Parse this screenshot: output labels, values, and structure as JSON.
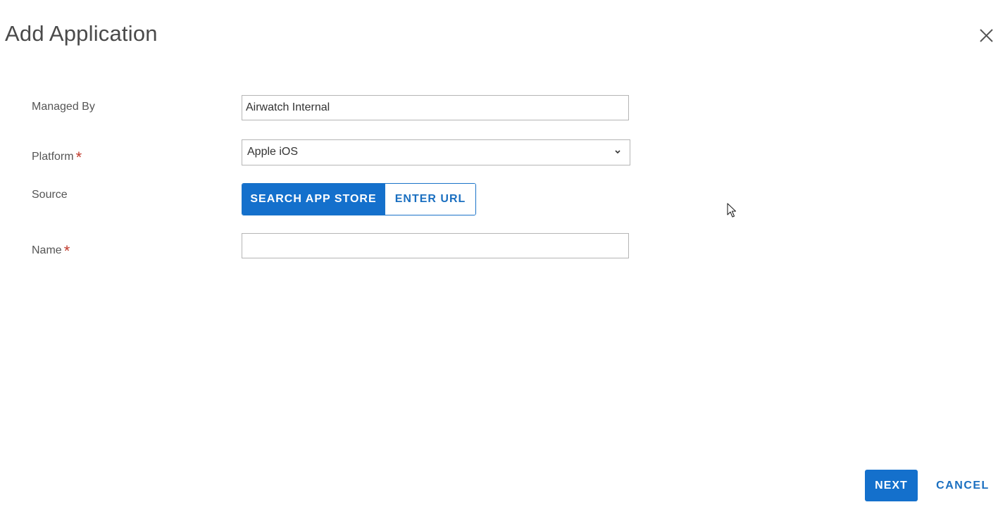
{
  "dialog": {
    "title": "Add Application",
    "close_icon": "close-icon"
  },
  "form": {
    "managed_by": {
      "label": "Managed By",
      "value": "Airwatch Internal"
    },
    "platform": {
      "label": "Platform",
      "required_mark": "*",
      "selected": "Apple iOS",
      "chevron_icon": "chevron-down-icon"
    },
    "source": {
      "label": "Source",
      "options": [
        {
          "label": "SEARCH APP STORE",
          "selected": true
        },
        {
          "label": "ENTER URL",
          "selected": false
        }
      ]
    },
    "name": {
      "label": "Name",
      "required_mark": "*",
      "value": "",
      "placeholder": ""
    }
  },
  "footer": {
    "next_label": "NEXT",
    "cancel_label": "CANCEL"
  },
  "colors": {
    "primary": "#1470cc",
    "required": "#c0392b",
    "border": "#b5b5b5"
  }
}
